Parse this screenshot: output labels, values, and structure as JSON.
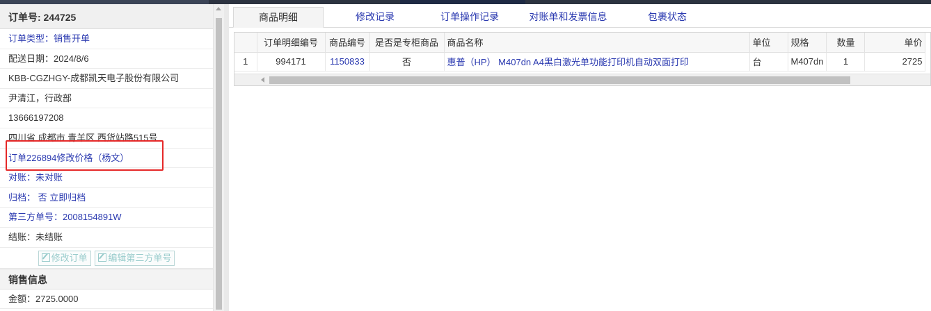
{
  "order": {
    "title": "订单号: 244725",
    "type": "订单类型：销售开单",
    "delivery_date": "配送日期：2024/8/6",
    "customer": "KBB-CGZHGY-成都凯天电子股份有限公司",
    "contact": "尹清江，行政部",
    "phone": "13666197208",
    "address": "四川省 成都市 青羊区 西货站路515号",
    "price_change": "订单226894修改价格（杨文）",
    "reconcile": "对账：未对账",
    "archive": "归档： 否 立即归档",
    "third_party": "第三方单号：2008154891W",
    "settlement": "结账：未结账",
    "edit_order_btn": "修改订单",
    "edit_third_btn": "编辑第三方单号",
    "sales_section": "销售信息",
    "amount": "金额：2725.0000"
  },
  "tabs": [
    "商品明细",
    "修改记录",
    "订单操作记录",
    "对账单和发票信息",
    "包裹状态"
  ],
  "table": {
    "headers": [
      "",
      "订单明细编号",
      "商品编号",
      "是否是专柜商品",
      "商品名称",
      "单位",
      "规格",
      "数量",
      "单价"
    ],
    "rows": [
      [
        "1",
        "994171",
        "1150833",
        "否",
        "惠普（HP） M407dn A4黑白激光单功能打印机自动双面打印",
        "台",
        "M407dn",
        "1",
        "2725"
      ]
    ]
  },
  "colors": {
    "link": "#2b3ab0",
    "highlight_box": "#e52828"
  },
  "icons": [
    "edit-icon",
    "scroll-up-icon",
    "scroll-left-icon"
  ]
}
